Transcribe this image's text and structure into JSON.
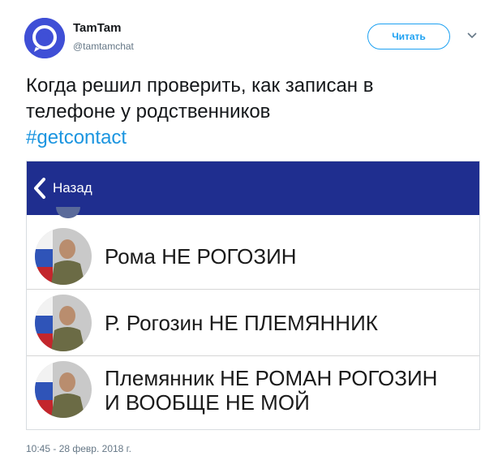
{
  "tweet": {
    "user_name": "TamTam",
    "user_handle": "@tamtamchat",
    "follow_label": "Читать",
    "text_line1": "Когда решил проверить, как записан в",
    "text_line2": "телефоне у родственников",
    "hashtag": "#getcontact",
    "timestamp": "10:45 - 28 февр. 2018 г."
  },
  "screenshot": {
    "back_label": "Назад",
    "nav_color": "#1f2e8f",
    "contacts": [
      {
        "name": "Рома НЕ РОГОЗИН"
      },
      {
        "name": "Р. Рогозин НЕ ПЛЕМЯННИК"
      },
      {
        "name": "Племянник НЕ РОМАН РОГОЗИН\nИ ВООБЩЕ НЕ МОЙ"
      }
    ]
  },
  "colors": {
    "accent": "#1da1f2",
    "hashtag": "#1b95e0",
    "avatar": "#3f4fd6"
  }
}
